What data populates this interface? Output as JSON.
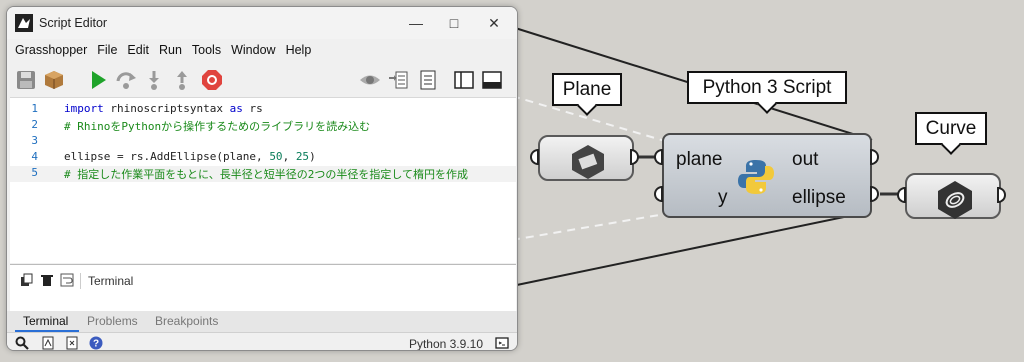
{
  "window": {
    "title": "Script Editor"
  },
  "menu": [
    "Grasshopper",
    "File",
    "Edit",
    "Run",
    "Tools",
    "Window",
    "Help"
  ],
  "code_lines": [
    {
      "n": "1",
      "parts": [
        {
          "t": "import",
          "c": "kw"
        },
        {
          "t": " rhinoscriptsyntax ",
          "c": ""
        },
        {
          "t": "as",
          "c": "kw"
        },
        {
          "t": " rs",
          "c": ""
        }
      ]
    },
    {
      "n": "2",
      "parts": [
        {
          "t": "# RhinoをPythonから操作するためのライブラリを読み込む",
          "c": "cm"
        }
      ]
    },
    {
      "n": "3",
      "parts": []
    },
    {
      "n": "4",
      "parts": [
        {
          "t": "ellipse = rs.AddEllipse(plane, ",
          "c": ""
        },
        {
          "t": "50",
          "c": "nm"
        },
        {
          "t": ", ",
          "c": ""
        },
        {
          "t": "25",
          "c": "nm"
        },
        {
          "t": ")",
          "c": ""
        }
      ]
    },
    {
      "n": "5",
      "parts": [
        {
          "t": "# 指定した作業平面をもとに、長半径と短半径の2つの半径を指定して楕円を作成",
          "c": "cm"
        }
      ]
    }
  ],
  "terminal": {
    "label": "Terminal"
  },
  "tabs": {
    "terminal": "Terminal",
    "problems": "Problems",
    "breakpoints": "Breakpoints"
  },
  "status": {
    "version": "Python 3.9.10"
  },
  "canvas": {
    "plane_bubble": "Plane",
    "python_bubble": "Python 3 Script",
    "curve_bubble": "Curve",
    "in_plane": "plane",
    "in_y": "y",
    "out_out": "out",
    "out_ellipse": "ellipse"
  },
  "colors": {
    "run_green": "#1fa32a",
    "stop_red": "#e0443e",
    "tab_accent": "#2a6fd6"
  }
}
